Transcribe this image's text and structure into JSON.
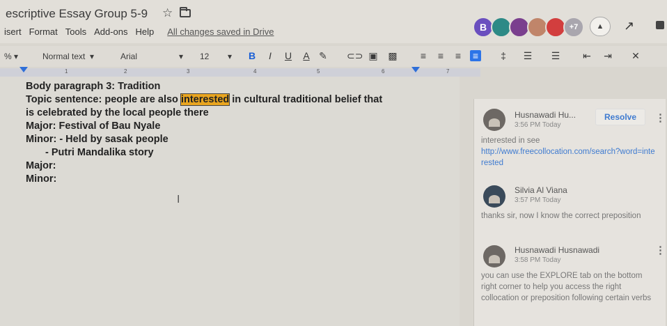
{
  "header": {
    "title": "escriptive Essay Group 5-9",
    "star_icon": "star-icon",
    "folder_icon": "folder-icon",
    "menus": [
      "isert",
      "Format",
      "Tools",
      "Add-ons",
      "Help"
    ],
    "save_status": "All changes saved in Drive",
    "avatar_initial": "B",
    "more_collaborators": "+7"
  },
  "toolbar": {
    "zoom": "%",
    "style": "Normal text",
    "font": "Arial",
    "size": "12",
    "bold": "B",
    "italic": "I",
    "underline": "U",
    "text_color": "A"
  },
  "ruler": {
    "numbers": [
      "1",
      "2",
      "3",
      "4",
      "5",
      "6",
      "7"
    ]
  },
  "document": {
    "line1": "Body paragraph 3: Tradition",
    "line2_before": "Topic sentence: people are also ",
    "line2_highlight": "interested",
    "line2_after": " in cultural traditional belief that",
    "line3": "is celebrated by the local people there",
    "line4": "Major: Festival of Bau Nyale",
    "line5": "Minor: - Held by sasak people",
    "line6": "-    Putri Mandalika story",
    "line7": "Major:",
    "line8": "Minor:"
  },
  "comments": [
    {
      "author": "Husnawadi Hu...",
      "time": "3:56 PM Today",
      "text": "interested in see",
      "link": "http://www.freecollocation.com/search?word=interested",
      "resolve": "Resolve"
    },
    {
      "author": "Silvia Al Viana",
      "time": "3:57 PM Today",
      "text": "thanks sir, now I know the correct preposition"
    },
    {
      "author": "Husnawadi Husnawadi",
      "time": "3:58 PM Today",
      "text": "you can use the EXPLORE tab on the bottom right corner to help you access the right collocation or preposition following certain verbs"
    }
  ],
  "colors": {
    "accent": "#2c74e8",
    "highlight": "#e9a51f",
    "link": "#3f7bd0"
  }
}
